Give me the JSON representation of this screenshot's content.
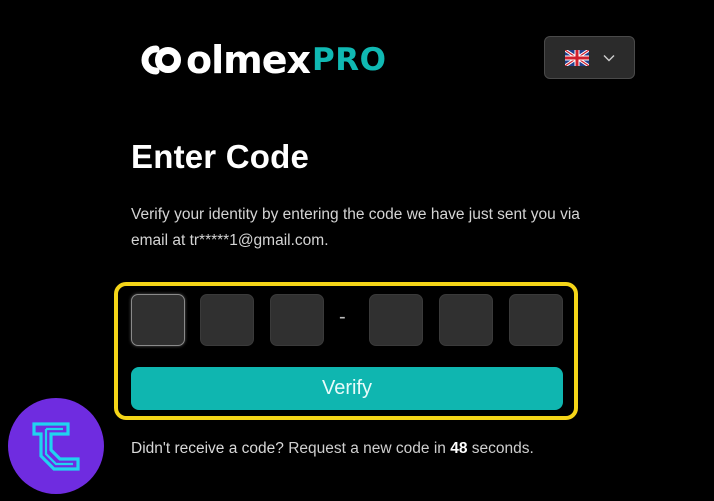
{
  "brand": {
    "word": "olmex",
    "pro": "PRO",
    "accent_color": "#10b9b3"
  },
  "language": {
    "selected_icon": "uk-flag-icon",
    "dropdown_icon": "chevron-down-icon"
  },
  "page": {
    "title": "Enter Code",
    "subtitle": "Verify your identity by entering the code we have just sent you via email at tr*****1@gmail.com."
  },
  "code": {
    "digits": [
      "",
      "",
      "",
      "",
      "",
      ""
    ],
    "separator": "-"
  },
  "actions": {
    "verify_label": "Verify",
    "verify_color": "#0fb6b0"
  },
  "resend": {
    "question": "Didn't receive a code?",
    "prefix": "Request a new code in",
    "seconds": "48",
    "suffix": "seconds."
  },
  "colors": {
    "background": "#000000",
    "highlight": "#f5d518",
    "badge": "#6f2ce0"
  }
}
